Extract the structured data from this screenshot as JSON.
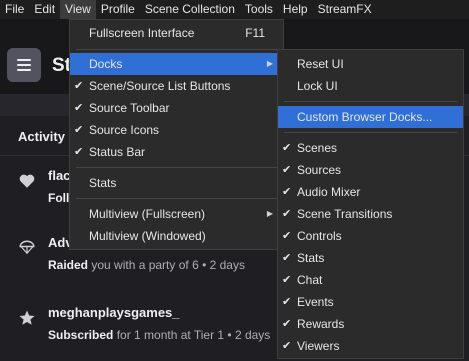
{
  "menubar": {
    "items": [
      "File",
      "Edit",
      "View",
      "Profile",
      "Scene Collection",
      "Tools",
      "Help",
      "StreamFX"
    ]
  },
  "header": {
    "title": "St"
  },
  "tabs": {
    "activity": "Activity"
  },
  "feed": {
    "item1": {
      "name": "flac",
      "detail": "Foll"
    },
    "item2": {
      "name": "AdvoHarGrace",
      "detail_strong": "Raided",
      "detail_rest": " you with a party of 6 • 2 days"
    },
    "item3": {
      "name": "meghanplaysgames_",
      "detail_strong": "Subscribed",
      "detail_rest": " for 1 month at Tier 1 • 2 days"
    }
  },
  "view_menu": {
    "fullscreen_interface": "Fullscreen Interface",
    "fullscreen_shortcut": "F11",
    "docks": "Docks",
    "scene_source_list_buttons": "Scene/Source List Buttons",
    "source_toolbar": "Source Toolbar",
    "source_icons": "Source Icons",
    "status_bar": "Status Bar",
    "stats": "Stats",
    "multiview_fullscreen": "Multiview (Fullscreen)",
    "multiview_windowed": "Multiview (Windowed)"
  },
  "docks_menu": {
    "reset_ui": "Reset UI",
    "lock_ui": "Lock UI",
    "custom_browser_docks": "Custom Browser Docks...",
    "scenes": "Scenes",
    "sources": "Sources",
    "audio_mixer": "Audio Mixer",
    "scene_transitions": "Scene Transitions",
    "controls": "Controls",
    "stats": "Stats",
    "chat": "Chat",
    "events": "Events",
    "rewards": "Rewards",
    "viewers": "Viewers"
  },
  "glyphs": {
    "check": "✔",
    "submenu_arrow": "▶"
  },
  "colors": {
    "highlight": "#2f6fd6",
    "menu_bg": "#2b2b2b",
    "app_bg": "#1f1f23"
  }
}
